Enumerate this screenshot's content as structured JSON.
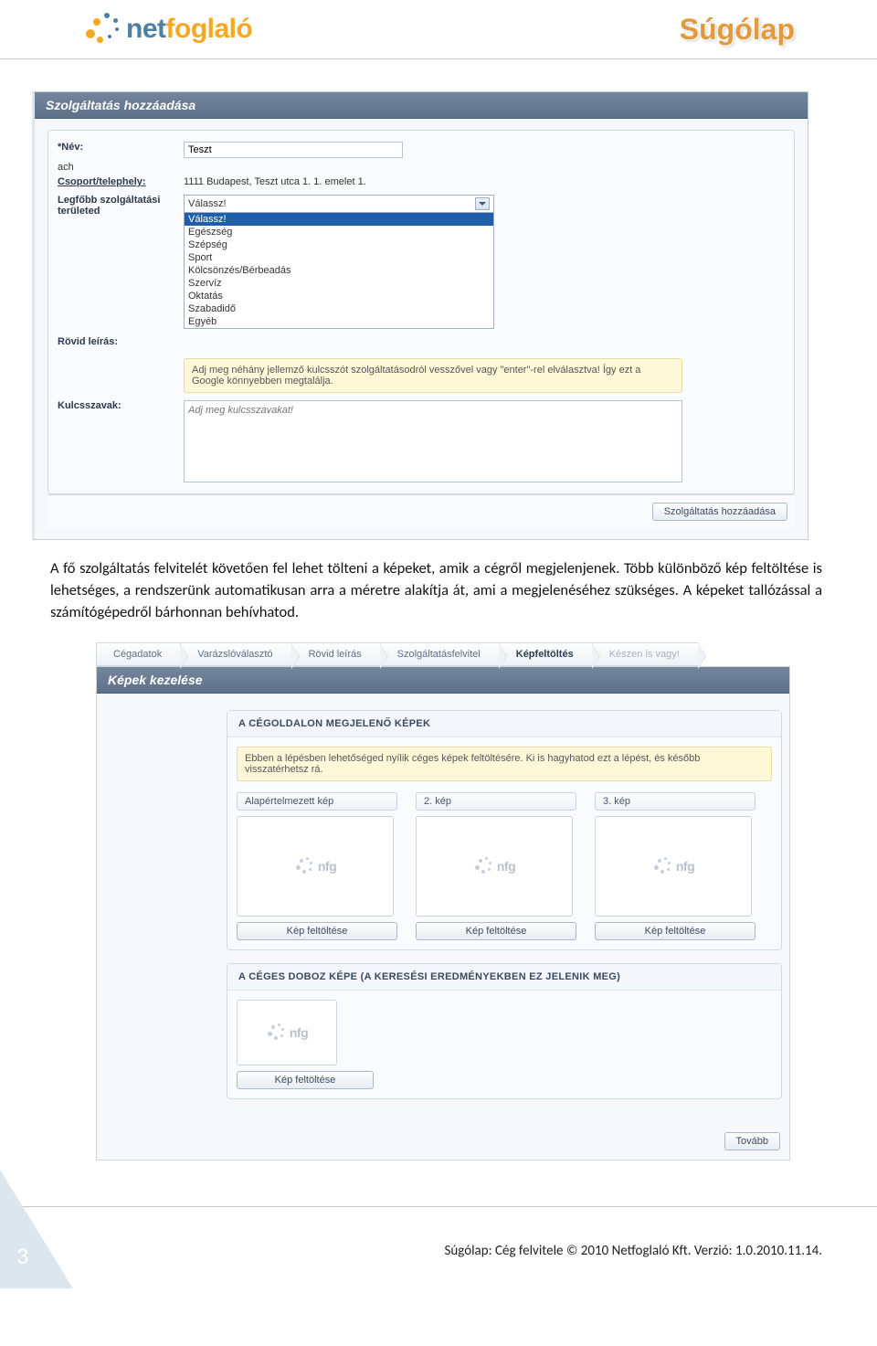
{
  "header": {
    "logo_prefix": "net",
    "logo_suffix": "foglaló",
    "title": "Súgólap"
  },
  "form1": {
    "panel_title": "Szolgáltatás hozzáadása",
    "name_label": "*Név:",
    "name_value": "Teszt",
    "group_label": "Csoport/telephely:",
    "group_value": "1111 Budapest, Teszt utca 1. 1. emelet 1.",
    "area_label": "Legfőbb szolgáltatási területed",
    "area_selected": "Válassz!",
    "options": [
      "Válassz!",
      "Egészség",
      "Szépség",
      "Sport",
      "Kölcsönzés/Bérbeadás",
      "Szervíz",
      "Oktatás",
      "Szabadidő",
      "Egyéb"
    ],
    "short_label": "Rövid leírás:",
    "hint": "Adj meg néhány jellemző kulcsszót szolgáltatásodról vesszővel vagy \"enter\"-rel elválasztva! Így ezt a Google könnyebben megtalálja.",
    "keyword_label": "Kulcsszavak:",
    "keyword_placeholder": "Adj meg kulcsszavakat!",
    "submit": "Szolgáltatás hozzáadása"
  },
  "paragraph": "A fő szolgáltatás felvitelét követően fel lehet tölteni a képeket, amik a cégről megjelenjenek. Több különböző kép feltöltése is lehetséges, a rendszerünk automatikusan arra a méretre alakítja át, ami a megjelenéséhez szükséges. A képeket tallózással a számítógépedről bárhonnan behívhatod.",
  "form2": {
    "crumbs": [
      "Cégadatok",
      "Varázslóválasztó",
      "Rövid leírás",
      "Szolgáltatásfelvitel",
      "Képfeltöltés",
      "Készen is vagy!"
    ],
    "active_crumb": 4,
    "panel_title": "Képek kezelése",
    "section1_title": "A CÉGOLDALON MEGJELENŐ KÉPEK",
    "section1_hint": "Ebben a lépésben lehetőséged nyílik céges képek feltöltésére. Ki is hagyhatod ezt a lépést, és később visszatérhetsz rá.",
    "thumbs": [
      {
        "label": "Alapértelmezett kép"
      },
      {
        "label": "2. kép"
      },
      {
        "label": "3. kép"
      }
    ],
    "upload_label": "Kép feltöltése",
    "nfg_text": "nfg",
    "section2_title": "A CÉGES DOBOZ KÉPE (A KERESÉSI EREDMÉNYEKBEN EZ JELENIK MEG)",
    "next": "Tovább"
  },
  "footer": {
    "page": "3",
    "text": "Súgólap: Cég felvitele   © 2010 Netfoglaló Kft. Verzió: 1.0.2010.11.14."
  }
}
